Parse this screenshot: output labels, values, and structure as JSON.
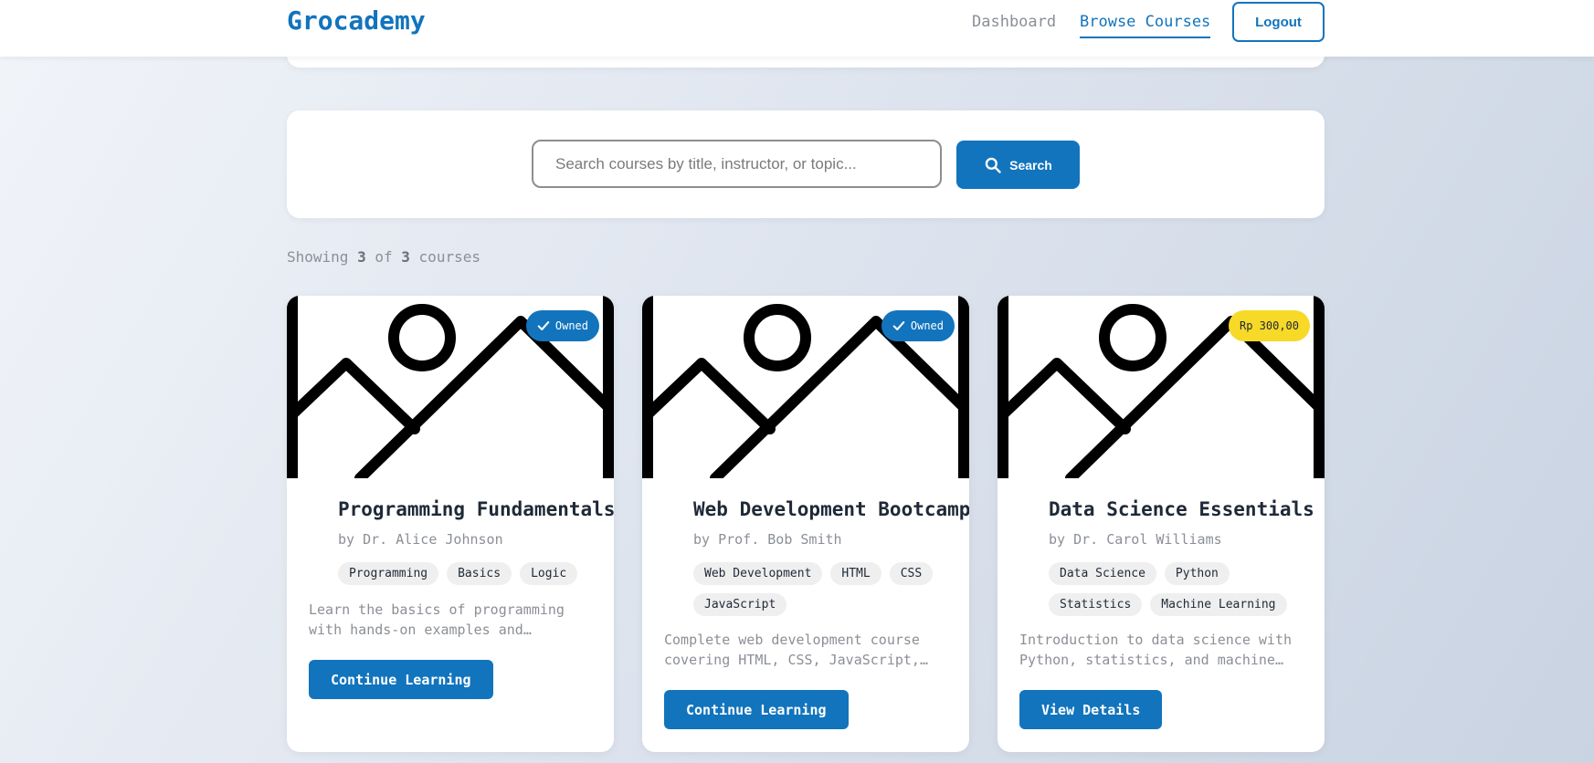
{
  "header": {
    "brand": "Grocademy",
    "nav": {
      "dashboard": "Dashboard",
      "browse": "Browse Courses"
    },
    "logout": "Logout"
  },
  "search": {
    "placeholder": "Search courses by title, instructor, or topic...",
    "button": "Search"
  },
  "results": {
    "prefix": "Showing",
    "shown": "3",
    "of": "of",
    "total": "3",
    "suffix": "courses"
  },
  "colors": {
    "accent": "#1274bd",
    "price_badge": "#f7d928"
  },
  "courses": [
    {
      "badge": "Owned",
      "badge_type": "owned",
      "title": "Programming Fundamentals",
      "author": "by Dr. Alice Johnson",
      "tags": [
        "Programming",
        "Basics",
        "Logic"
      ],
      "description": "Learn the basics of programming with hands-on examples and exercises.",
      "button": "Continue Learning"
    },
    {
      "badge": "Owned",
      "badge_type": "owned",
      "title": "Web Development Bootcamp",
      "author": "by Prof. Bob Smith",
      "tags": [
        "Web Development",
        "HTML",
        "CSS",
        "JavaScript"
      ],
      "description": "Complete web development course covering HTML, CSS, JavaScript, and more.",
      "button": "Continue Learning"
    },
    {
      "badge": "Rp 300,00",
      "badge_type": "price",
      "title": "Data Science Essentials",
      "author": "by Dr. Carol Williams",
      "tags": [
        "Data Science",
        "Python",
        "Statistics",
        "Machine Learning"
      ],
      "description": "Introduction to data science with Python, statistics, and machine learning.",
      "button": "View Details"
    }
  ]
}
